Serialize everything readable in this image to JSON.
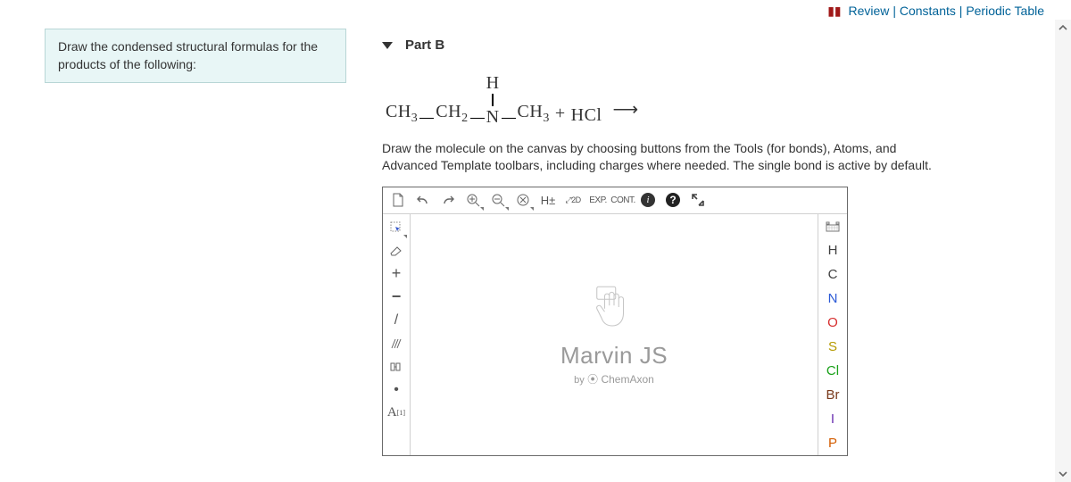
{
  "top_links": {
    "review": "Review",
    "constants": "Constants",
    "periodic": "Periodic Table"
  },
  "prompt": "Draw the condensed structural formulas for the products of the following:",
  "part": {
    "title": "Part B",
    "reaction": {
      "r1": "CH",
      "r1s": "3",
      "r2": "CH",
      "r2s": "2",
      "nTop": "H",
      "nMid": "N",
      "r3": "CH",
      "r3s": "3",
      "plus": "+",
      "r4": "HCl",
      "arrow": "⟶"
    },
    "instructions": "Draw the molecule on the canvas by choosing buttons from the Tools (for bonds), Atoms, and Advanced Template toolbars, including charges where needed. The single bond is active by default."
  },
  "sketcher": {
    "top_tools": {
      "new": "new-icon",
      "undo": "undo-icon",
      "redo": "redo-icon",
      "zoom_in": "zoom-in-icon",
      "zoom_out": "zoom-out-icon",
      "delete": "delete-icon",
      "hplus": "H±",
      "two_d": "2D",
      "exp": "EXP.",
      "cont": "CONT.",
      "info": "i",
      "help": "?",
      "fullscreen": "fullscreen-icon"
    },
    "left_tools": {
      "select": "select-icon",
      "erase": "erase-icon",
      "plus": "+",
      "minus": "−",
      "single": "/",
      "double": "double-bond-icon",
      "chain": "chain-icon",
      "dot": "•",
      "atom_label": "A",
      "atom_label_sup": "[1]"
    },
    "canvas": {
      "brand": "Marvin JS",
      "by": "by",
      "company": "ChemAxon"
    },
    "right_tools": {
      "periodic": "periodic-table-icon",
      "atoms": [
        "H",
        "C",
        "N",
        "O",
        "S",
        "Cl",
        "Br",
        "I",
        "P"
      ]
    }
  }
}
